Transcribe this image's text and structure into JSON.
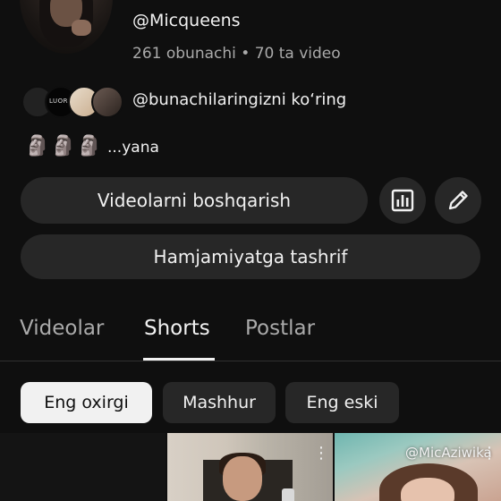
{
  "channel": {
    "handle": "@Micqueens",
    "stats": "261 obunachi • 70 ta video",
    "subscribers_link": "@bunachilaringizni ko‘ring",
    "subscriber_avatars": [
      {
        "name": "subscriber-avatar-1"
      },
      {
        "name": "subscriber-avatar-2",
        "text": "LUORKA"
      },
      {
        "name": "subscriber-avatar-3"
      },
      {
        "name": "subscriber-avatar-4"
      }
    ],
    "moai_icons": [
      "🗿",
      "🗿",
      "🗿"
    ],
    "more_text": "...yana"
  },
  "actions": {
    "manage_videos": "Videolarni boshqarish",
    "analytics_icon": "analytics-bar-chart-icon",
    "edit_icon": "pencil-edit-icon",
    "visit_community": "Hamjamiyatga tashrif"
  },
  "tabs": [
    {
      "label": "Videolar",
      "active": false
    },
    {
      "label": "Shorts",
      "active": true
    },
    {
      "label": "Postlar",
      "active": false
    }
  ],
  "filters": [
    {
      "label": "Eng oxirgi",
      "selected": true
    },
    {
      "label": "Mashhur",
      "selected": false
    },
    {
      "label": "Eng eski",
      "selected": false
    }
  ],
  "shorts": [
    {
      "overlay": ""
    },
    {
      "overlay": ""
    },
    {
      "overlay": "@MicAziwika"
    }
  ],
  "colors": {
    "background": "#0f0f0f",
    "surface": "#272727",
    "text_primary": "#f1f1f1",
    "text_secondary": "#aaaaaa"
  }
}
